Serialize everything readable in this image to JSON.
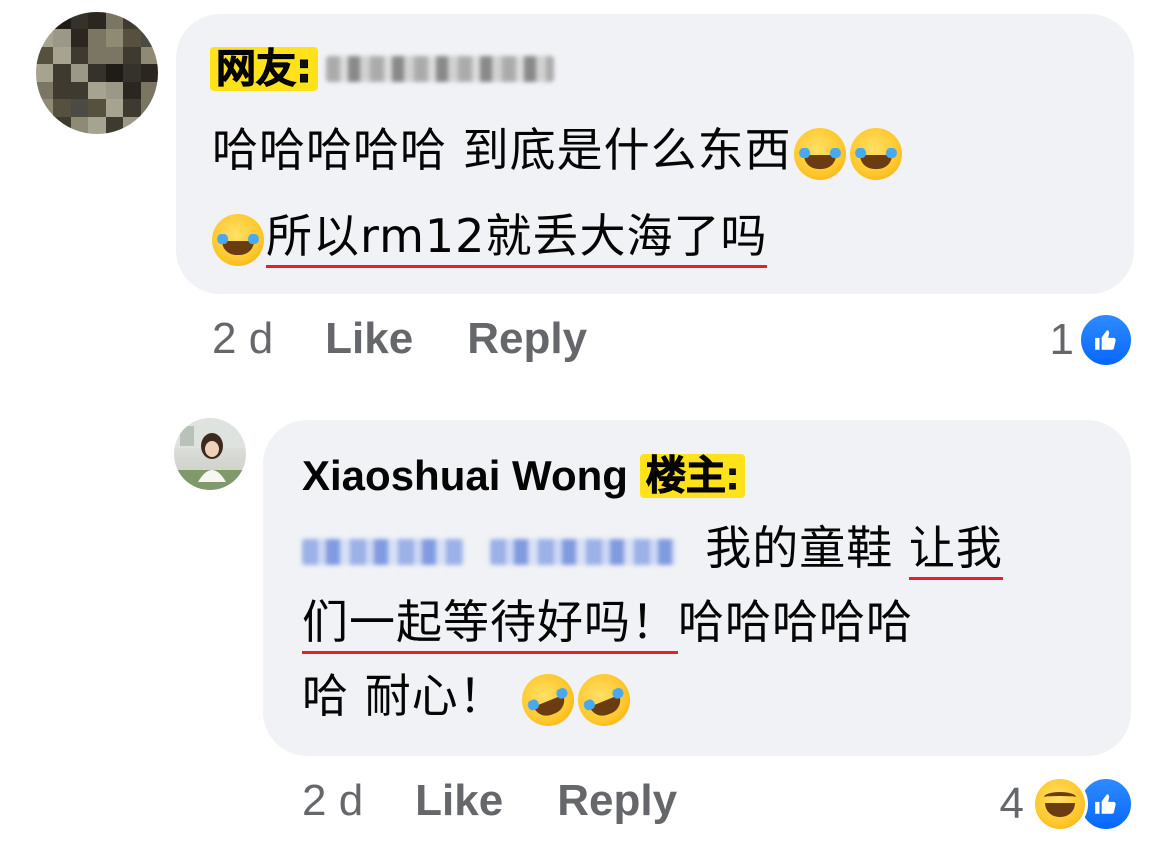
{
  "comment1": {
    "tag": "网友:",
    "text_line1": "哈哈哈哈哈 到底是什么东西",
    "text_line2": "所以rm12就丢大海了吗",
    "time": "2 d",
    "like_label": "Like",
    "reply_label": "Reply",
    "reaction_count": "1",
    "reaction_icons": [
      "like-icon"
    ]
  },
  "comment2": {
    "author": "Xiaoshuai Wong",
    "tag": "楼主:",
    "text_line1_a": "我的童鞋 ",
    "text_line1_b": "让我",
    "text_line2_a": "们一起等待好吗！",
    "text_line2_b": "哈哈哈哈哈",
    "text_line3": "哈 耐心！",
    "time": "2 d",
    "like_label": "Like",
    "reply_label": "Reply",
    "reaction_count": "4",
    "reaction_icons": [
      "haha-icon",
      "like-icon"
    ]
  },
  "colors": {
    "bubble": "#f0f2f5",
    "tag_highlight": "#ffe21a",
    "underline": "#e2212b",
    "like_blue": "#0866ff",
    "meta_grey": "#65676b"
  }
}
